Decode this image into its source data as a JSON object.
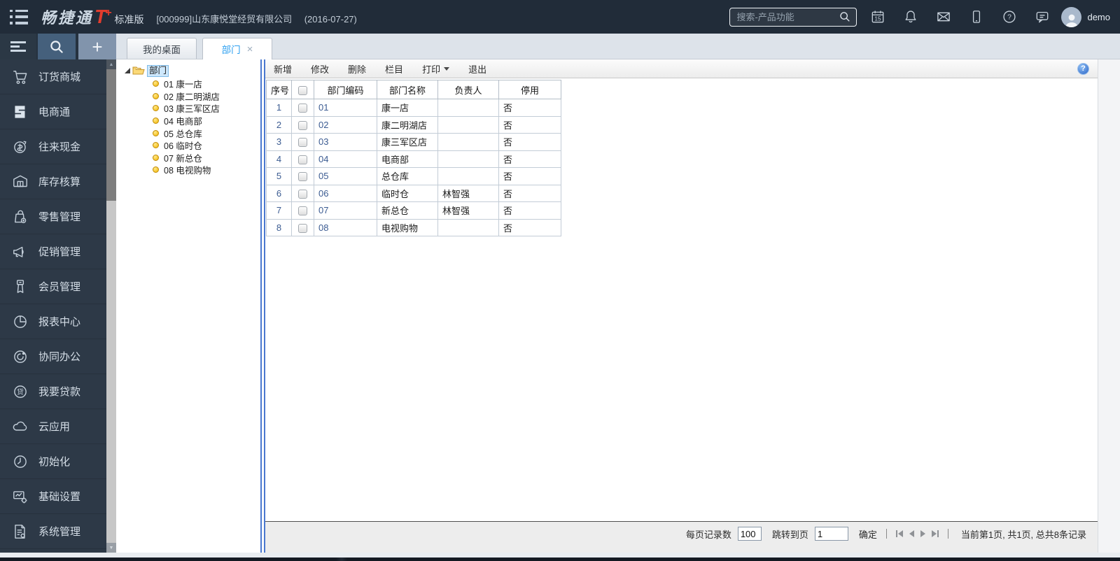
{
  "topbar": {
    "brand": "畅捷通",
    "brand_mark": "T",
    "brand_plus": "+",
    "edition": "标准版",
    "company": "[000999]山东康悦堂经贸有限公司",
    "date": "(2016-07-27)",
    "search_placeholder": "搜索-产品功能",
    "calendar_day": "15",
    "username": "demo",
    "icons": [
      "menu-list-icon",
      "search-icon",
      "calendar-icon",
      "bell-icon",
      "mail-icon",
      "phone-icon",
      "help-icon",
      "chat-icon",
      "avatar"
    ]
  },
  "subbar": {
    "icons": [
      "collapse-menu-icon",
      "search-icon",
      "add-tab-icon"
    ]
  },
  "tabs": [
    {
      "label": "我的桌面",
      "active": false
    },
    {
      "label": "部门",
      "active": true,
      "close": "×"
    }
  ],
  "sidebar": {
    "items": [
      {
        "label": "订货商城",
        "icon": "cart-icon"
      },
      {
        "label": "电商通",
        "icon": "ecommerce-icon"
      },
      {
        "label": "往来现金",
        "icon": "cash-circle-icon"
      },
      {
        "label": "库存核算",
        "icon": "warehouse-icon"
      },
      {
        "label": "零售管理",
        "icon": "shopping-bag-icon"
      },
      {
        "label": "促销管理",
        "icon": "megaphone-icon"
      },
      {
        "label": "会员管理",
        "icon": "member-badge-icon"
      },
      {
        "label": "报表中心",
        "icon": "pie-chart-icon"
      },
      {
        "label": "协同办公",
        "icon": "collaboration-icon"
      },
      {
        "label": "我要贷款",
        "icon": "loan-icon",
        "glyph": "贷"
      },
      {
        "label": "云应用",
        "icon": "cloud-icon"
      },
      {
        "label": "初始化",
        "icon": "clock-icon"
      },
      {
        "label": "基础设置",
        "icon": "base-settings-icon"
      },
      {
        "label": "系统管理",
        "icon": "system-doc-icon"
      }
    ]
  },
  "tree": {
    "root": "部门",
    "items": [
      "01 康一店",
      "02 康二明湖店",
      "03 康三军区店",
      "04 电商部",
      "05 总仓库",
      "06 临时仓",
      "07 新总仓",
      "08 电视购物"
    ]
  },
  "toolbar": {
    "new": "新增",
    "edit": "修改",
    "delete": "删除",
    "columns": "栏目",
    "print": "打印",
    "exit": "退出"
  },
  "table": {
    "columns": {
      "seq": "序号",
      "code": "部门编码",
      "name": "部门名称",
      "manager": "负责人",
      "disabled": "停用"
    },
    "rows": [
      {
        "seq": "1",
        "code": "01",
        "name": "康一店",
        "manager": "",
        "disabled": "否"
      },
      {
        "seq": "2",
        "code": "02",
        "name": "康二明湖店",
        "manager": "",
        "disabled": "否"
      },
      {
        "seq": "3",
        "code": "03",
        "name": "康三军区店",
        "manager": "",
        "disabled": "否"
      },
      {
        "seq": "4",
        "code": "04",
        "name": "电商部",
        "manager": "",
        "disabled": "否"
      },
      {
        "seq": "5",
        "code": "05",
        "name": "总仓库",
        "manager": "",
        "disabled": "否"
      },
      {
        "seq": "6",
        "code": "06",
        "name": "临时仓",
        "manager": "林智强",
        "disabled": "否"
      },
      {
        "seq": "7",
        "code": "07",
        "name": "新总仓",
        "manager": "林智强",
        "disabled": "否"
      },
      {
        "seq": "8",
        "code": "08",
        "name": "电视购物",
        "manager": "",
        "disabled": "否"
      }
    ]
  },
  "pagination": {
    "per_page_label": "每页记录数",
    "per_page_value": "100",
    "goto_label": "跳转到页",
    "goto_value": "1",
    "confirm_label": "确定",
    "summary": "当前第1页, 共1页, 总共8条记录",
    "icons": [
      "first-page-icon",
      "prev-page-icon",
      "next-page-icon",
      "last-page-icon"
    ]
  },
  "colors": {
    "topbar_bg": "#212c39",
    "sidebar_bg": "#2d3947",
    "accent_blue": "#2b9ff0",
    "brand_red": "#e23c2d",
    "splitter_blue": "#4a78cf",
    "tree_selection": "#cde7fb"
  }
}
